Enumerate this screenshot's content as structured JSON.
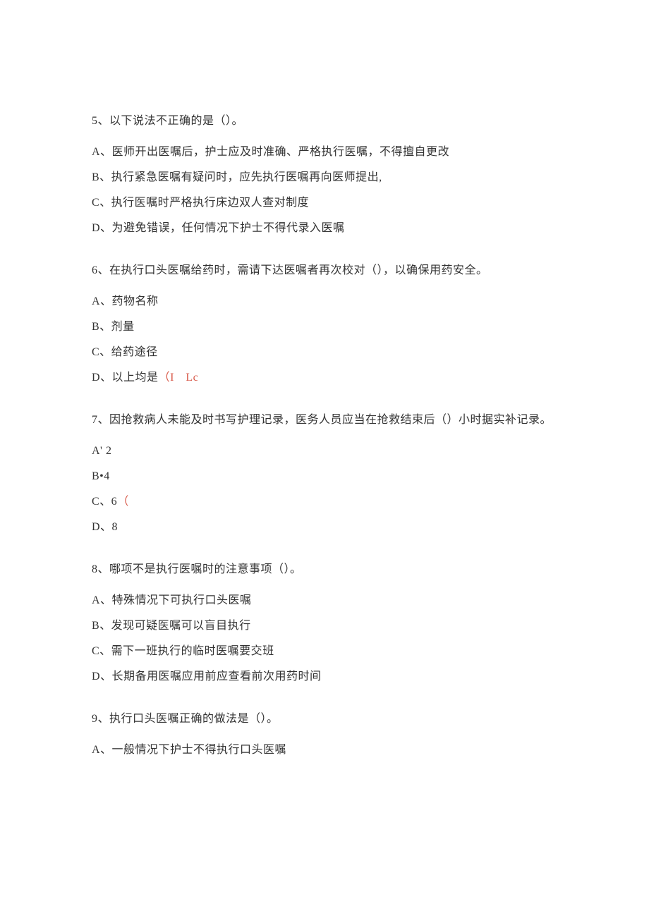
{
  "q5": {
    "stem": "5、以下说法不正确的是（）。",
    "A": "A、医师开出医嘱后，护士应及时准确、严格执行医嘱，不得擅自更改",
    "B": "B、执行紧急医嘱有疑问时，应先执行医嘱再向医师提出,",
    "C": "C、执行医嘱时严格执行床边双人查对制度",
    "D": "D、为避免错误，任何情况下护士不得代录入医嘱"
  },
  "q6": {
    "stem": "6、在执行口头医嘱给药时，需请下达医嘱者再次校对（），以确保用药安全。",
    "A": "A、药物名称",
    "B": "B、剂量",
    "C": "C、给药途径",
    "D_prefix": "D、以上均是",
    "D_red": "（I　Lc"
  },
  "q7": {
    "stem": "7、因抢救病人未能及时书写护理记录，医务人员应当在抢救结束后（）小时据实补记录。",
    "A": "A' 2",
    "B": "B•4",
    "C_prefix": "C、6",
    "C_red": "（",
    "D": "D、8"
  },
  "q8": {
    "stem": "8、哪项不是执行医嘱时的注意事项（）。",
    "A": "A、特殊情况下可执行口头医嘱",
    "B": "B、发现可疑医嘱可以盲目执行",
    "C": "C、需下一班执行的临时医嘱要交班",
    "D": "D、长期备用医嘱应用前应查看前次用药时间"
  },
  "q9": {
    "stem": "9、执行口头医嘱正确的做法是（）。",
    "A": "A、一般情况下护士不得执行口头医嘱"
  }
}
